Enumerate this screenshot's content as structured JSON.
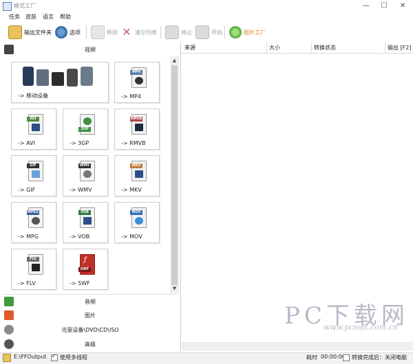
{
  "window": {
    "title": "格式工厂"
  },
  "menu": [
    "任务",
    "皮肤",
    "语言",
    "帮助"
  ],
  "toolbar": {
    "output_folder": "输出文件夹",
    "options": "选项",
    "remove": "移除",
    "clear_list": "清空列表",
    "stop": "停止",
    "start": "开始",
    "picture_factory": "图片工厂"
  },
  "left": {
    "video_label": "视频",
    "tiles": [
      {
        "label": "-> 移动设备",
        "tag": "",
        "color": "#3a6fb0"
      },
      {
        "label": "-> MP4",
        "tag": "MP4",
        "color": "#5a7fa8"
      },
      {
        "label": "-> AVI",
        "tag": "AVI",
        "color": "#4e8f3a"
      },
      {
        "label": "-> 3GP",
        "tag": "3GP",
        "color": "#3f8f3f"
      },
      {
        "label": "-> RMVB",
        "tag": "RMVB",
        "color": "#b04848"
      },
      {
        "label": "-> GIF",
        "tag": "GIF",
        "color": "#333333"
      },
      {
        "label": "-> WMV",
        "tag": "WMV",
        "color": "#333333"
      },
      {
        "label": "-> MKV",
        "tag": "MKV",
        "color": "#c07a40"
      },
      {
        "label": "-> MPG",
        "tag": "MPEG",
        "color": "#3a5fa0"
      },
      {
        "label": "-> VOB",
        "tag": "VOB",
        "color": "#2e7a3a"
      },
      {
        "label": "-> MOV",
        "tag": "MOV",
        "color": "#2f6fb5"
      },
      {
        "label": "-> FLV",
        "tag": "FLV",
        "color": "#6a6a6a"
      },
      {
        "label": "-> SWF",
        "tag": "SWF",
        "color": "#c0302a"
      }
    ],
    "categories": {
      "audio": "音频",
      "picture": "图片",
      "rom": "光驱设备\\DVD\\CD\\ISO",
      "advanced": "高级"
    }
  },
  "table": {
    "columns": [
      "来源",
      "大小",
      "转换状态",
      "输出 [F2]"
    ]
  },
  "status": {
    "path": "E:\\FFOutput",
    "multithread": "使用多线程",
    "time_label": "耗时",
    "time_value": "00:00:00",
    "after_label": "转换完成后：关闭电脑"
  },
  "watermark": {
    "big": "PC下载网",
    "url": "www.pcsoft.com.cn"
  },
  "colors": {
    "accent": "#3a6fb0",
    "orange_text": "#e07b1a"
  }
}
